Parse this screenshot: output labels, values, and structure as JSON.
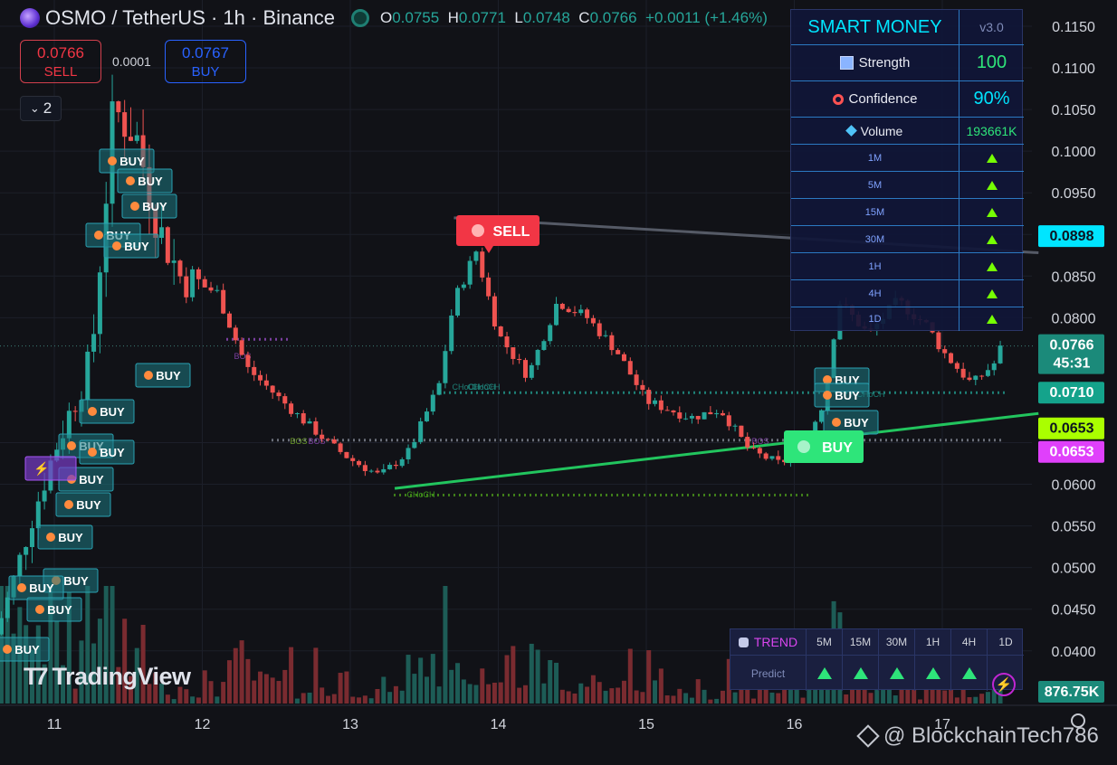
{
  "header": {
    "symbol": "OSMO / TetherUS · 1h · Binance",
    "ohlc": [
      {
        "key": "O",
        "value": "0.0755"
      },
      {
        "key": "H",
        "value": "0.0771"
      },
      {
        "key": "L",
        "value": "0.0748"
      },
      {
        "key": "C",
        "value": "0.0766"
      }
    ],
    "change": "+0.0011 (+1.46%)"
  },
  "trade": {
    "sell_price": "0.0766",
    "sell_label": "SELL",
    "buy_price": "0.0767",
    "buy_label": "BUY",
    "spread": "0.0001"
  },
  "indicator_toggle": {
    "count": "2"
  },
  "smart_money": {
    "title": "SMART MONEY",
    "version": "v3.0",
    "strength_label": "Strength",
    "strength_value": "100",
    "confidence_label": "Confidence",
    "confidence_value": "90%",
    "volume_label": "Volume",
    "volume_value": "193661K",
    "timeframes": [
      "1M",
      "5M",
      "15M",
      "30M",
      "1H",
      "4H",
      "1D"
    ],
    "timeframe_signal": "up"
  },
  "trend_panel": {
    "label": "TREND",
    "predict_label": "Predict",
    "timeframes": [
      "5M",
      "15M",
      "30M",
      "1H",
      "4H",
      "1D"
    ],
    "signal": "up"
  },
  "axis": {
    "y_ticks": [
      "0.1150",
      "0.1100",
      "0.1050",
      "0.1000",
      "0.0950",
      "0.0850",
      "0.0800",
      "0.0600",
      "0.0550",
      "0.0500",
      "0.0450",
      "0.0400"
    ],
    "x_ticks": [
      "11",
      "12",
      "13",
      "14",
      "15",
      "16",
      "17"
    ],
    "price_tags": [
      {
        "value": "0.0898",
        "bg": "#00e5ff",
        "fg": "#0b1320"
      },
      {
        "value": "0.0766",
        "sub": "45:31",
        "bg": "#1b8a7a",
        "fg": "#ffffff"
      },
      {
        "value": "0.0710",
        "bg": "#14a38b",
        "fg": "#ffffff"
      },
      {
        "value": "0.0653",
        "bg": "#aaff00",
        "fg": "#0b1320"
      },
      {
        "value": "0.0653",
        "bg": "#e040fb",
        "fg": "#ffffff"
      },
      {
        "value": "876.75K",
        "bg": "#1b8a7a",
        "fg": "#ffffff"
      }
    ]
  },
  "signals": {
    "buy_text": "BUY",
    "sell_text": "SELL",
    "big_buy_text": "BUY",
    "structure_labels": [
      "BOS",
      "CHoCH",
      "BOS",
      "CHoCH",
      "BOS",
      "CHoCH",
      "CHoCH",
      "BOS",
      "CHoCH"
    ]
  },
  "branding": {
    "logo": "TradingView",
    "watermark": "@ BlockchainTech786"
  },
  "colors": {
    "up": "#26a69a",
    "down": "#ef5350",
    "background": "#111217",
    "accent": "#00e5ff"
  },
  "chart_data": {
    "type": "candlestick",
    "x_axis_labels": [
      "11",
      "12",
      "13",
      "14",
      "15",
      "16",
      "17"
    ],
    "ylim": [
      0.036,
      0.117
    ],
    "close_path": [
      [
        10.6,
        0.042
      ],
      [
        10.7,
        0.047
      ],
      [
        10.85,
        0.056
      ],
      [
        11.0,
        0.064
      ],
      [
        11.25,
        0.075
      ],
      [
        11.4,
        0.105
      ],
      [
        11.55,
        0.102
      ],
      [
        11.7,
        0.091
      ],
      [
        11.85,
        0.085
      ],
      [
        12.1,
        0.083
      ],
      [
        12.3,
        0.074
      ],
      [
        12.6,
        0.069
      ],
      [
        12.85,
        0.065
      ],
      [
        13.0,
        0.063
      ],
      [
        13.2,
        0.061
      ],
      [
        13.4,
        0.064
      ],
      [
        13.6,
        0.072
      ],
      [
        13.7,
        0.082
      ],
      [
        13.85,
        0.088
      ],
      [
        14.0,
        0.078
      ],
      [
        14.2,
        0.073
      ],
      [
        14.4,
        0.082
      ],
      [
        14.6,
        0.08
      ],
      [
        14.8,
        0.076
      ],
      [
        15.0,
        0.07
      ],
      [
        15.3,
        0.068
      ],
      [
        15.5,
        0.069
      ],
      [
        15.7,
        0.064
      ],
      [
        15.9,
        0.0625
      ],
      [
        16.05,
        0.064
      ],
      [
        16.2,
        0.07
      ],
      [
        16.3,
        0.082
      ],
      [
        16.5,
        0.078
      ],
      [
        16.7,
        0.082
      ],
      [
        16.9,
        0.079
      ],
      [
        17.0,
        0.076
      ],
      [
        17.2,
        0.072
      ],
      [
        17.35,
        0.0745
      ],
      [
        17.4,
        0.0766
      ]
    ],
    "levels": [
      {
        "name": "BOS",
        "y": 0.0774
      },
      {
        "name": "CHoCH",
        "y": 0.071
      },
      {
        "name": "CHoCH",
        "y": 0.0653
      },
      {
        "name": "CHoCH",
        "y": 0.0587
      }
    ],
    "trendlines": [
      {
        "x1": 13.3,
        "y1": 0.0595,
        "x2": 17.65,
        "y2": 0.0685,
        "color": "#22c55e"
      },
      {
        "x1": 13.7,
        "y1": 0.092,
        "x2": 17.65,
        "y2": 0.0878,
        "color": "#555a66"
      }
    ],
    "volume_peak": "876.75K"
  }
}
